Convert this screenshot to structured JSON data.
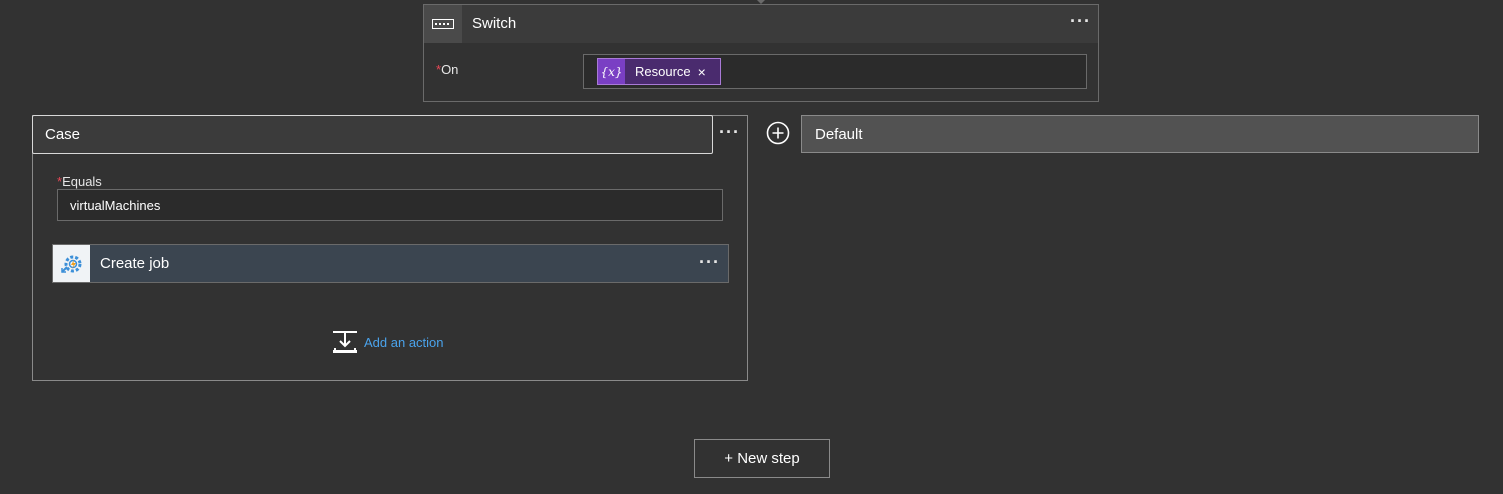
{
  "switch": {
    "title": "Switch",
    "more_label": "···",
    "on_label": "On",
    "required_mark": "*",
    "token": {
      "icon_text": "{x}",
      "label": "Resource",
      "remove_label": "×"
    }
  },
  "case": {
    "title": "Case",
    "more_label": "···",
    "equals_label": "Equals",
    "required_mark": "*",
    "equals_value": "virtualMachines",
    "action": {
      "title": "Create job",
      "more_label": "···",
      "icon": "automation-job-icon"
    },
    "add_action_label": "Add an action"
  },
  "default": {
    "title": "Default",
    "add_icon": "plus-circle-icon"
  },
  "new_step_label": "+ New step",
  "colors": {
    "background": "#323232",
    "header": "#3b3b3b",
    "token_bg": "#4a2b6e",
    "token_icon_bg": "#7a3fc4",
    "link": "#4aa3ec",
    "required": "#e74856"
  }
}
